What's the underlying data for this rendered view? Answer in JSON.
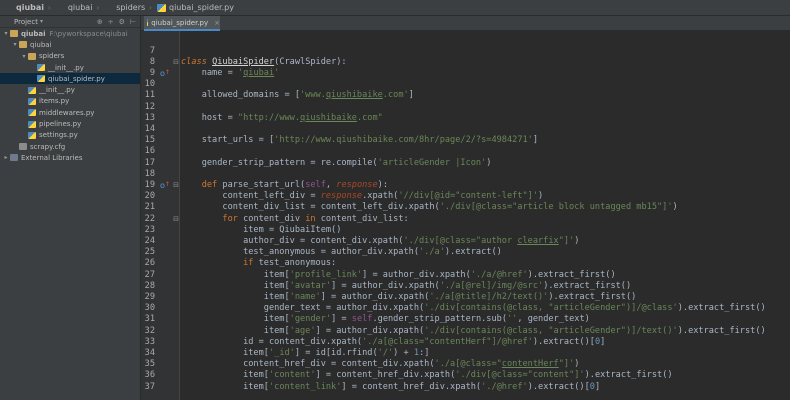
{
  "breadcrumb": [
    {
      "label": "qiubai",
      "icon": "folder-icon",
      "bold": true
    },
    {
      "label": "qiubai",
      "icon": "folder-icon",
      "bold": false
    },
    {
      "label": "spiders",
      "icon": "folder-icon",
      "bold": false
    },
    {
      "label": "qiubai_spider.py",
      "icon": "python-file-icon",
      "bold": false
    }
  ],
  "project_panel": {
    "title": "Project",
    "tree": [
      {
        "label": "qiubai",
        "path": "F:\\pyworkspace\\qiubai",
        "icon": "folder-icon",
        "arrow": "▾",
        "depth": 0
      },
      {
        "label": "qiubai",
        "icon": "folder-icon",
        "arrow": "▾",
        "depth": 1
      },
      {
        "label": "spiders",
        "icon": "folder-icon",
        "arrow": "▾",
        "depth": 2
      },
      {
        "label": "__init__.py",
        "icon": "python-file-icon",
        "arrow": "",
        "depth": 3
      },
      {
        "label": "qiubai_spider.py",
        "icon": "python-file-icon",
        "arrow": "",
        "depth": 3,
        "selected": true
      },
      {
        "label": "__init__.py",
        "icon": "python-file-icon",
        "arrow": "",
        "depth": 2
      },
      {
        "label": "items.py",
        "icon": "python-file-icon",
        "arrow": "",
        "depth": 2
      },
      {
        "label": "middlewares.py",
        "icon": "python-file-icon",
        "arrow": "",
        "depth": 2
      },
      {
        "label": "pipelines.py",
        "icon": "python-file-icon",
        "arrow": "",
        "depth": 2
      },
      {
        "label": "settings.py",
        "icon": "python-file-icon",
        "arrow": "",
        "depth": 2
      },
      {
        "label": "scrapy.cfg",
        "icon": "config-file-icon",
        "arrow": "",
        "depth": 1
      },
      {
        "label": "External Libraries",
        "icon": "library-icon",
        "arrow": "▸",
        "depth": 0
      }
    ]
  },
  "editor": {
    "tab_label": "qiubai_spider.py",
    "lines": [
      {
        "n": "7",
        "t": ""
      },
      {
        "n": "8",
        "t": "<span class='kw it'>class</span> <span class='cls'>QiubaiSpider</span>(CrawlSpider):"
      },
      {
        "n": "9",
        "t": "    name = <span class='str'>'<span class='ul'>qiubai</span>'</span>"
      },
      {
        "n": "10",
        "t": ""
      },
      {
        "n": "11",
        "t": "    allowed_domains = [<span class='str'>'www.<span class='ul'>qiushibaike</span>.com'</span>]"
      },
      {
        "n": "12",
        "t": ""
      },
      {
        "n": "13",
        "t": "    host = <span class='str'>\"http://www.<span class='ul'>qiushibaike</span>.com\"</span>"
      },
      {
        "n": "14",
        "t": ""
      },
      {
        "n": "15",
        "t": "    start_urls = [<span class='str'>'http://www.qiushibaike.com/8hr/page/2/?s=4984271'</span>]"
      },
      {
        "n": "16",
        "t": ""
      },
      {
        "n": "17",
        "t": "    gender_strip_pattern = re.compile(<span class='str'>'articleGender |Icon'</span>)"
      },
      {
        "n": "18",
        "t": ""
      },
      {
        "n": "19",
        "t": "    <span class='kw'>def</span> parse_start_url(<span class='slf'>self</span>, <span class='prm'>response</span>):"
      },
      {
        "n": "20",
        "t": "        content_left_div = <span class='prm'>response</span>.xpath(<span class='str'>'//div[@id=\"content-left\"]'</span>)"
      },
      {
        "n": "21",
        "t": "        content_div_list = content_left_div.xpath(<span class='str'>'./div[@class=\"article block untagged mb15\"]'</span>)"
      },
      {
        "n": "22",
        "t": "        <span class='kw'>for</span> content_div <span class='kw'>in</span> content_div_list:"
      },
      {
        "n": "23",
        "t": "            item = QiubaiItem()"
      },
      {
        "n": "24",
        "t": "            author_div = content_div.xpath(<span class='str'>'./div[@class=\"author <span class='ul'>clearfix</span>\"]'</span>)"
      },
      {
        "n": "25",
        "t": "            test_anonymous = author_div.xpath(<span class='str'>'./a'</span>).extract()"
      },
      {
        "n": "26",
        "t": "            <span class='kw'>if</span> test_anonymous:"
      },
      {
        "n": "27",
        "t": "                item[<span class='str'>'profile_link'</span>] = author_div.xpath(<span class='str'>'./a/@href'</span>).extract_first()"
      },
      {
        "n": "28",
        "t": "                item[<span class='str'>'avatar'</span>] = author_div.xpath(<span class='str'>'./a[@rel]/img/@src'</span>).extract_first()"
      },
      {
        "n": "29",
        "t": "                item[<span class='str'>'name'</span>] = author_div.xpath(<span class='str'>'./a[@title]/h2/text()'</span>).extract_first()"
      },
      {
        "n": "30",
        "t": "                gender_text = author_div.xpath(<span class='str'>'./div[contains(@class, \"articleGender\")]/@class'</span>).extract_first()"
      },
      {
        "n": "31",
        "t": "                item[<span class='str'>'gender'</span>] = <span class='slf'>self</span>.gender_strip_pattern.sub(<span class='str'>''</span>, gender_text)"
      },
      {
        "n": "32",
        "t": "                item[<span class='str'>'age'</span>] = author_div.xpath(<span class='str'>'./div[contains(@class, \"articleGender\")]/text()'</span>).extract_first()"
      },
      {
        "n": "33",
        "t": "            id = content_div.xpath(<span class='str'>'./a[@class=\"contentHerf\"]/@href'</span>).extract()[<span class='num'>0</span>]"
      },
      {
        "n": "34",
        "t": "            item[<span class='str'>'_id'</span>] = id[id.rfind(<span class='str'>'/'</span>) + <span class='num'>1</span>:]"
      },
      {
        "n": "35",
        "t": "            content_href_div = content_div.xpath(<span class='str'>'./a[@class=\"<span class='ul'>contentHerf</span>\"]'</span>)"
      },
      {
        "n": "36",
        "t": "            item[<span class='str'>'content'</span>] = content_href_div.xpath(<span class='str'>'./div[@class=\"content\"]'</span>).extract_first()"
      },
      {
        "n": "37",
        "t": "            item[<span class='str'>'content_link'</span>] = content_href_div.xpath(<span class='str'>'./@href'</span>).extract()[<span class='num'>0</span>]"
      }
    ]
  }
}
